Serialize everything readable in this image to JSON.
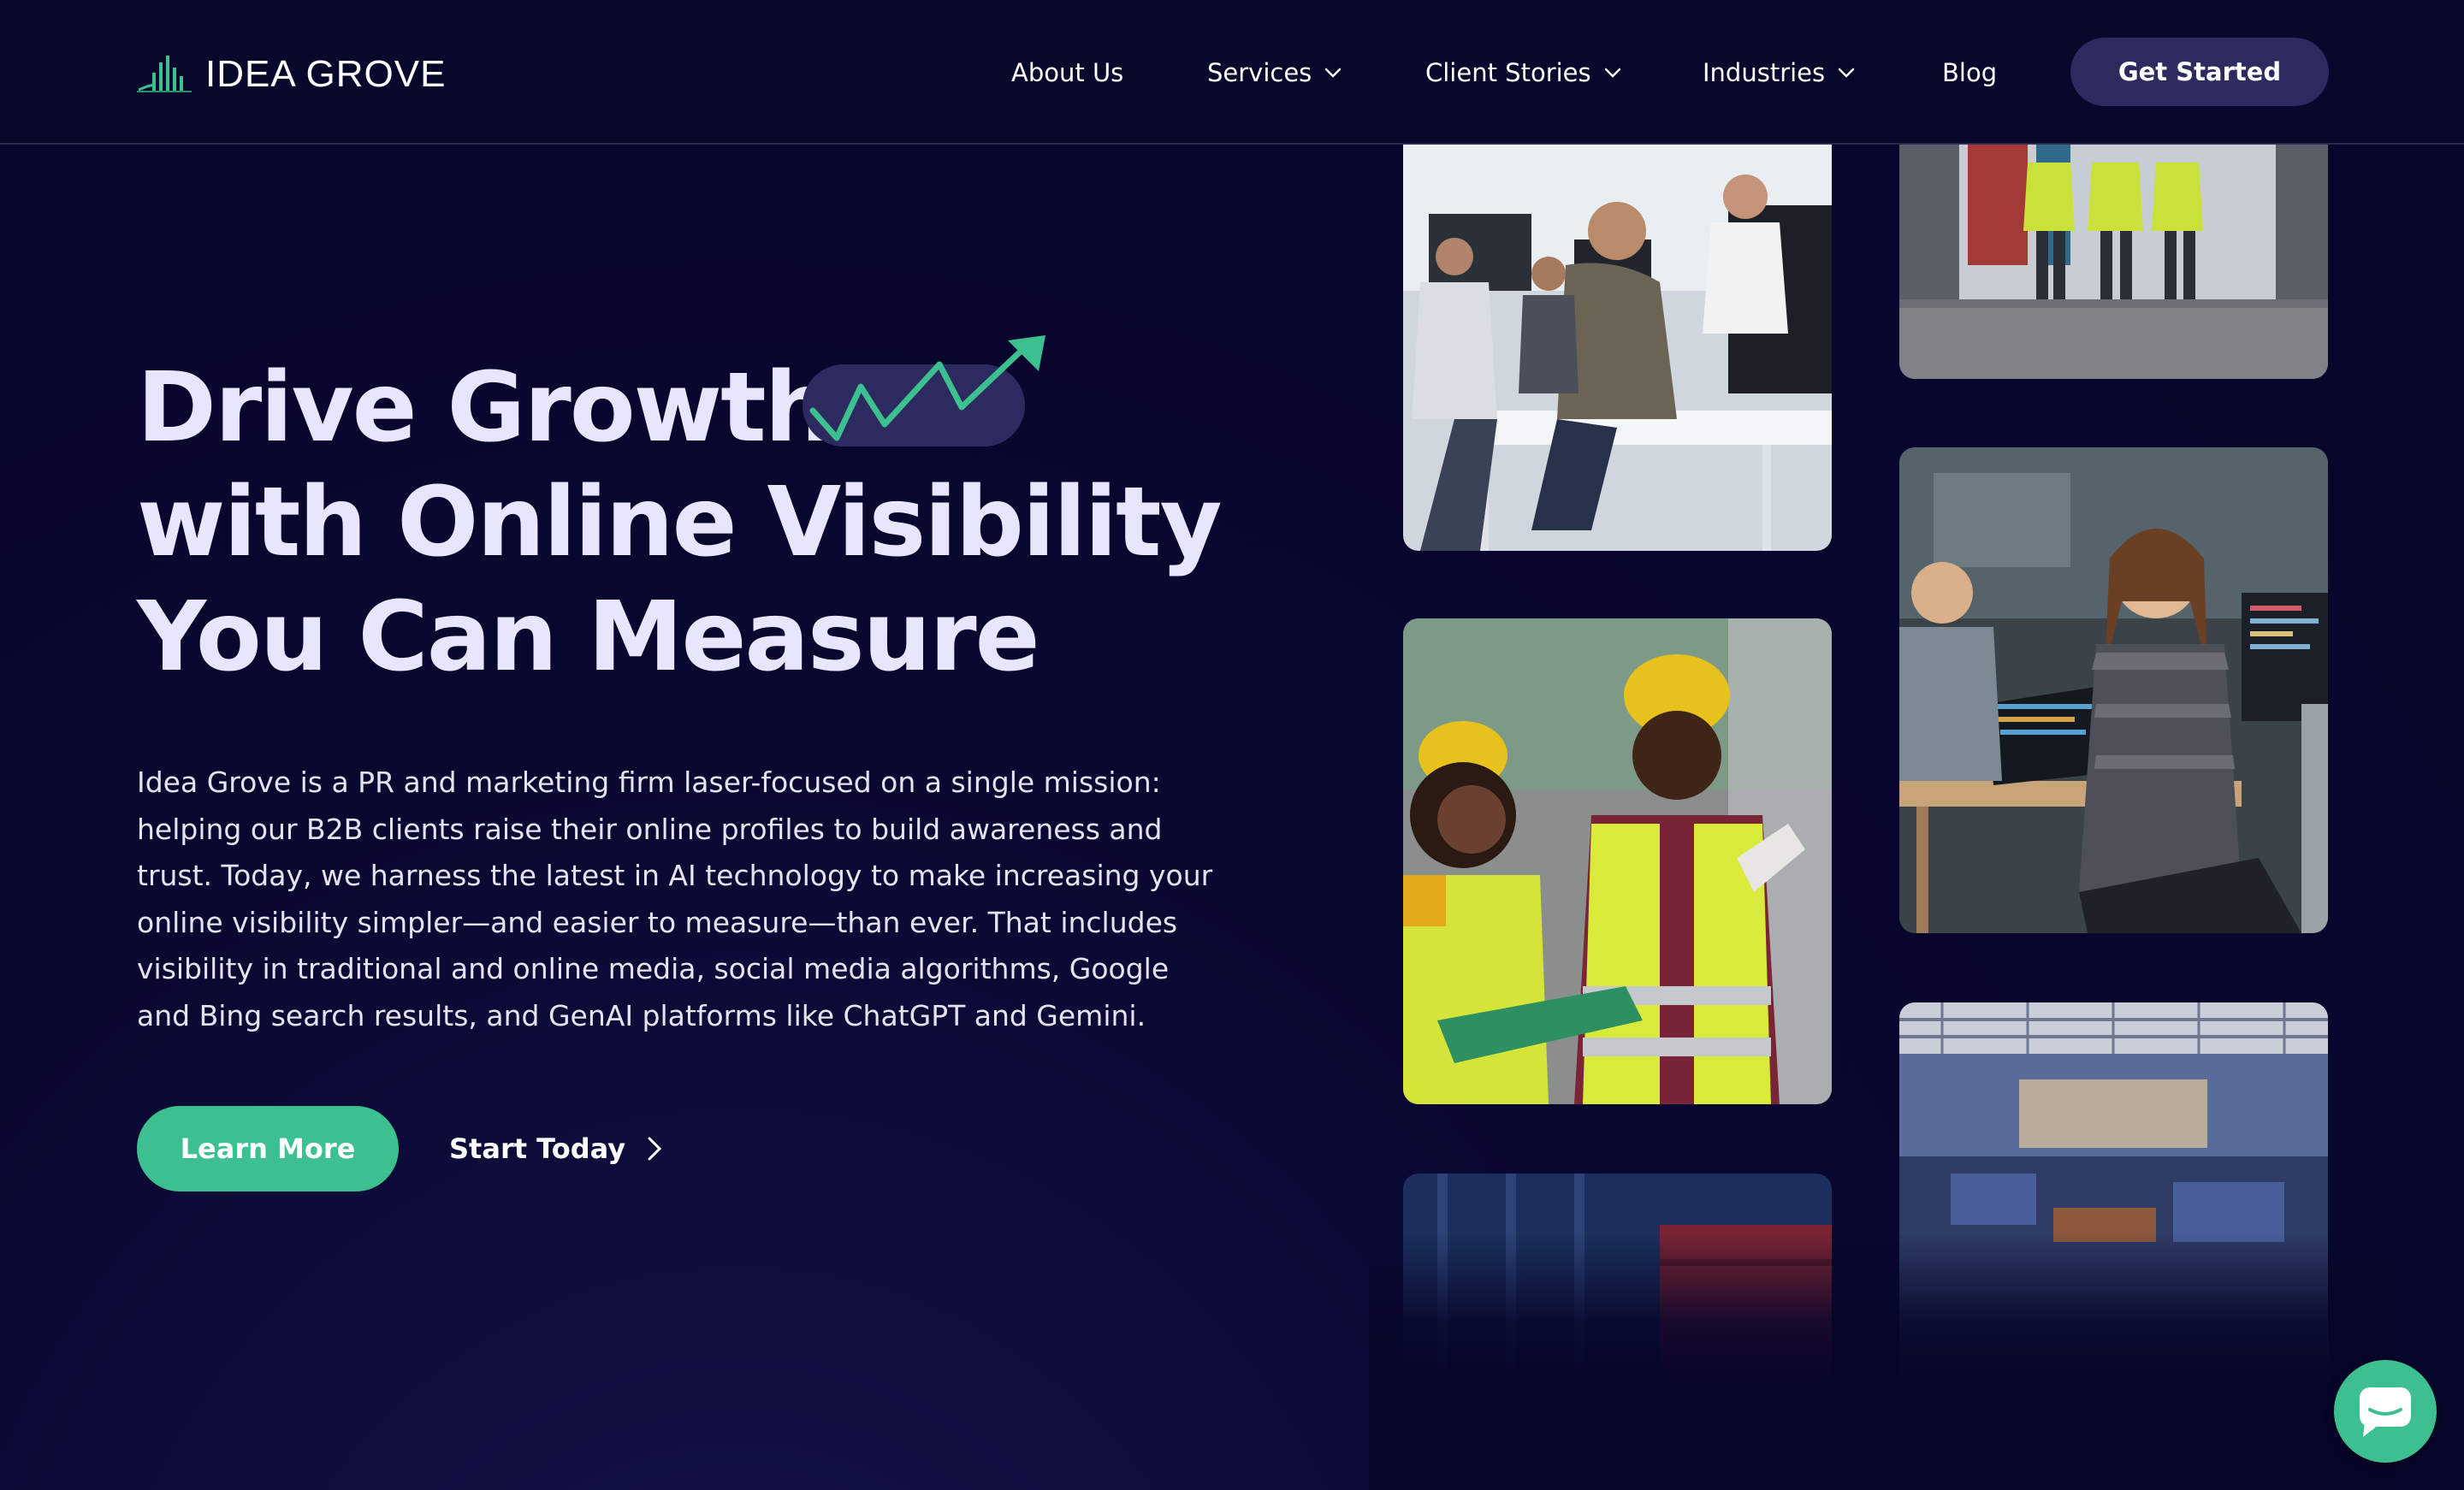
{
  "brand": {
    "name": "IDEA GROVE",
    "accent": "#3cc08f",
    "background": "#06052a",
    "button_dark": "#2c2a5e"
  },
  "nav": {
    "items": [
      {
        "label": "About Us",
        "has_dropdown": false
      },
      {
        "label": "Services",
        "has_dropdown": true
      },
      {
        "label": "Client Stories",
        "has_dropdown": true
      },
      {
        "label": "Industries",
        "has_dropdown": true
      },
      {
        "label": "Blog",
        "has_dropdown": false
      }
    ],
    "cta_label": "Get Started"
  },
  "hero": {
    "title_lines": [
      "Drive Growth",
      "with Online Visibility",
      "You Can Measure"
    ],
    "description": "Idea Grove is a PR and marketing firm laser-focused on a single mission: helping our B2B clients raise their online profiles to build awareness and trust. Today, we harness the latest in AI technology to make increasing your online visibility simpler—and easier to measure—than ever. That includes visibility in traditional and online media, social media algorithms, Google and Bing search results, and GenAI platforms like ChatGPT and Gemini.",
    "primary_button": "Learn More",
    "secondary_button": "Start Today"
  },
  "photos": [
    {
      "name": "office-team-photo",
      "icon": "photo"
    },
    {
      "name": "warehouse-workers-photo",
      "icon": "photo"
    },
    {
      "name": "factory-workers-photo",
      "icon": "photo"
    },
    {
      "name": "developer-woman-photo",
      "icon": "photo"
    },
    {
      "name": "shipping-container-photo",
      "icon": "photo"
    },
    {
      "name": "industrial-plant-photo",
      "icon": "photo"
    }
  ],
  "chat": {
    "icon": "chat-icon"
  }
}
